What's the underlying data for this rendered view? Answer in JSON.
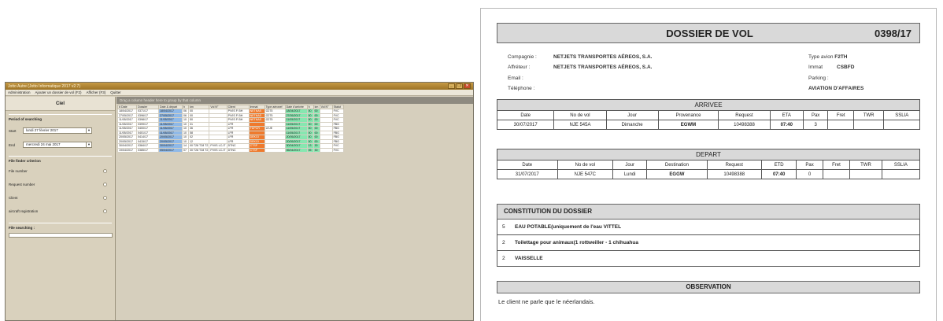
{
  "app": {
    "title": "Jotto Autre (Jotto Informatique 2017 v2.7)",
    "window_buttons": [
      "_",
      "❐",
      "✕"
    ],
    "menu": [
      "Administration",
      "Ajouter un dossier de vol (F2)",
      "Afficher (F3)",
      "Quitter"
    ],
    "side": {
      "header": "Ciel",
      "period_title": "Period of searching",
      "start_label": "Start",
      "start_value": "lundi 27 février 2017",
      "end_label": "End",
      "end_value": "mercredi 24 mai 2017",
      "filter_title": "File finder criterion",
      "filters": [
        "File number",
        "Request number",
        "Client",
        "aircraft registration"
      ],
      "search_title": "File searching :"
    },
    "groupbar": "Drag a column header here to group by that column",
    "grid": {
      "headers": [
        "# Date",
        "Dossier",
        "Date & départ",
        "h",
        "km",
        "Vol N°",
        "Client",
        "Immat",
        "Type aéronef",
        "Date d'arrivée",
        "h",
        "km",
        "Vol N°",
        "Statut"
      ],
      "rows": [
        [
          "18/04/2017",
          "0371/17",
          "18/04/2017",
          "06",
          "00",
          "",
          "P/VIS Fl 5H",
          "NETNAS",
          "G275",
          "18/04/2017",
          "00",
          "00",
          "",
          "FVC"
        ],
        [
          "27/05/2017",
          "0396/17",
          "27/05/2017",
          "06",
          "00",
          "",
          "P/VIS Fl 5H",
          "NETNAS",
          "G275",
          "27/05/2017",
          "00",
          "00",
          "",
          "FVC"
        ],
        [
          "11/05/2017",
          "0398/17",
          "11/05/2017",
          "10",
          "50",
          "",
          "P/VIS Fl 5H",
          "NETNAS",
          "G275",
          "11/05/2017",
          "00",
          "00",
          "",
          "FVC"
        ],
        [
          "11/05/2017",
          "0399/17",
          "11/05/2017",
          "10",
          "31",
          "",
          "LFR",
          "",
          "",
          "11/05/2017",
          "00",
          "00",
          "",
          "FBG"
        ],
        [
          "11/05/2017",
          "0400/17",
          "11/05/2017",
          "10",
          "36",
          "",
          "LFR",
          "FDPCR",
          "LEJE",
          "11/05/2017",
          "00",
          "00",
          "",
          "FBG"
        ],
        [
          "11/05/2017",
          "0401/17",
          "11/05/2017",
          "10",
          "58",
          "",
          "LFR",
          "",
          "",
          "11/05/2017",
          "00",
          "00",
          "",
          "FBG"
        ],
        [
          "20/05/2017",
          "0414/17",
          "20/05/2017",
          "10",
          "02",
          "",
          "LFR",
          "DEKGI",
          "",
          "20/05/2017",
          "00",
          "00",
          "",
          "FBG"
        ],
        [
          "20/05/2017",
          "0415/17",
          "20/05/2017",
          "10",
          "12",
          "",
          "LFR",
          "DEKGI",
          "",
          "20/05/2017",
          "00",
          "00",
          "",
          "FBG"
        ],
        [
          "30/04/2017",
          "0384/17",
          "30/04/2017",
          "14",
          "00 T28 T28 T2",
          "P/VIS LC-IT",
          "DTNC",
          "CTSP",
          "",
          "30/04/2017",
          "13",
          "30",
          "",
          "FVC"
        ],
        [
          "19/04/2017",
          "0385/17",
          "05/04/2017",
          "07",
          "30 T28 T28 T2",
          "P/VIS LC-IT",
          "DTNC",
          "CTSP",
          "",
          "06/04/2017",
          "05",
          "30",
          "",
          "FVC"
        ]
      ]
    }
  },
  "doc": {
    "title": "DOSSIER DE VOL",
    "number": "0398/17",
    "compagnie_label": "Compagnie :",
    "compagnie_value": "NETJETS TRANSPORTES AÉREOS, S.A.",
    "affreteur_label": "Affréteur :",
    "affreteur_value": "NETJETS TRANSPORTES AÉREOS, S.A.",
    "email_label": "Email :",
    "telephone_label": "Téléphone :",
    "type_avion_label": "Type avion",
    "type_avion_value": "F2TH",
    "immat_label": "Immat",
    "immat_value": "CSBFD",
    "parking_label": "Parking :",
    "parking_value": "AVIATION D'AFFAIRES",
    "arrivee": {
      "title": "ARRIVEE",
      "headers": [
        "Date",
        "No de vol",
        "Jour",
        "Provenance",
        "Request",
        "ETA",
        "Pax",
        "Fret",
        "TWR",
        "SSLIA"
      ],
      "row": [
        "30/07/2017",
        "NJE 545A",
        "Dimanche",
        "EGWM",
        "10498388",
        "07:40",
        "3",
        "",
        "",
        ""
      ]
    },
    "depart": {
      "title": "DEPART",
      "headers": [
        "Date",
        "No de vol",
        "Jour",
        "Destination",
        "Request",
        "ETD",
        "Pax",
        "Fret",
        "TWR",
        "SSLIA"
      ],
      "row": [
        "31/07/2017",
        "NJE 547C",
        "Lundi",
        "EGGW",
        "10498388",
        "07:40",
        "0",
        "",
        "",
        ""
      ]
    },
    "constitution": {
      "title": "CONSTITUTION DU DOSSIER",
      "items": [
        {
          "qty": "5",
          "text": "EAU POTABLE(uniquement de l'eau VITTEL"
        },
        {
          "qty": "2",
          "text": "Toilettage pour animaux(1 rottweiller - 1 chihuahua"
        },
        {
          "qty": "2",
          "text": "VAISSELLE"
        }
      ]
    },
    "observation": {
      "title": "OBSERVATION",
      "text": "Le client ne parle que le néerlandais."
    }
  },
  "colors": {
    "blue_cell": "#8fb9e8",
    "orange_cell": "#ef7a2d",
    "green_cell": "#86e7b0",
    "title_bar": "#b58632"
  }
}
